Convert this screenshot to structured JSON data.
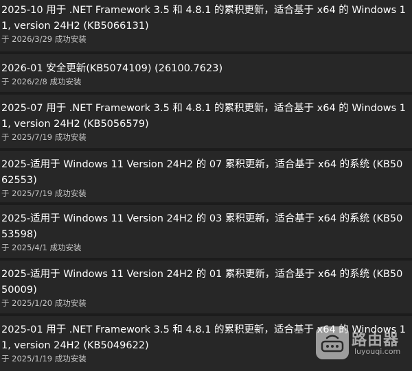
{
  "updates": [
    {
      "title": "2025-10 用于 .NET Framework 3.5 和 4.8.1 的累积更新，适合基于 x64 的 Windows 11, version 24H2 (KB5066131)",
      "status": "于 2026/3/29 成功安装"
    },
    {
      "title": "2026-01 安全更新(KB5074109) (26100.7623)",
      "status": "于 2026/2/8 成功安装"
    },
    {
      "title": "2025-07 用于 .NET Framework 3.5 和 4.8.1 的累积更新，适合基于 x64 的 Windows 11, version 24H2 (KB5056579)",
      "status": "于 2025/7/19 成功安装"
    },
    {
      "title": "2025-适用于 Windows 11 Version 24H2 的 07 累积更新，适合基于 x64 的系统 (KB5062553)",
      "status": "于 2025/7/19 成功安装"
    },
    {
      "title": "2025-适用于 Windows 11 Version 24H2 的 03 累积更新，适合基于 x64 的系统 (KB5053598)",
      "status": "于 2025/4/1 成功安装"
    },
    {
      "title": "2025-适用于 Windows 11 Version 24H2 的 01 累积更新，适合基于 x64 的系统 (KB5050009)",
      "status": "于 2025/1/20 成功安装"
    },
    {
      "title": "2025-01 用于 .NET Framework 3.5 和 4.8.1 的累积更新，适合基于 x64 的 Windows 11, version 24H2 (KB5049622)",
      "status": "于 2025/1/19 成功安装"
    }
  ],
  "watermark": {
    "name": "路由器",
    "url": "luyouqi.com",
    "icon": "router-logo-icon"
  },
  "colors": {
    "background": "#1c1c1c",
    "item_background": "#272727",
    "title_text": "#ffffff",
    "status_text": "#c5c5c5"
  }
}
